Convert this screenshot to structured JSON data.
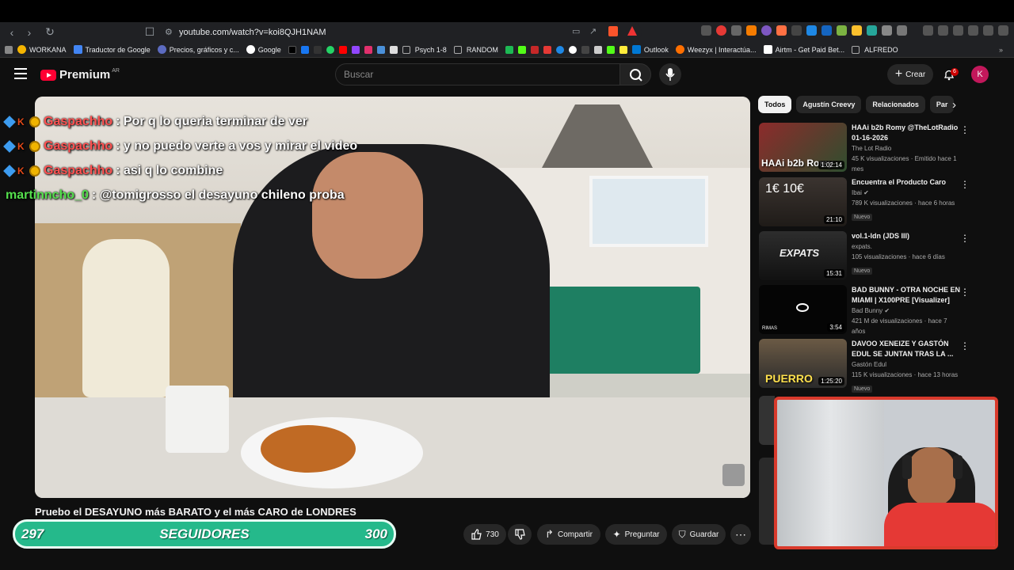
{
  "browser": {
    "url": "youtube.com/watch?v=koi8QJH1NAM",
    "bookmarks": [
      "WORKANA",
      "Traductor de Google",
      "Precios, gráficos y c...",
      "Google",
      "Psych 1-8",
      "RANDOM",
      "Outlook",
      "Weezyx | Interactúa...",
      "Airtm - Get Paid Bet...",
      "ALFREDO"
    ]
  },
  "header": {
    "logo_text": "Premium",
    "country": "AR",
    "search_placeholder": "Buscar",
    "create_label": "Crear",
    "notif_count": "6",
    "avatar_letter": "K"
  },
  "chat": [
    {
      "user": "Gaspachho",
      "msg": ": Por q lo queria terminar de ver",
      "color": "red"
    },
    {
      "user": "Gaspachho",
      "msg": ": y no puedo verte a vos y mirar el video",
      "color": "red"
    },
    {
      "user": "Gaspachho",
      "msg": ": asi q lo combine",
      "color": "red"
    },
    {
      "user": "martinncho_0",
      "msg": ": @tomigrosso el desayuno chileno proba",
      "color": "green"
    }
  ],
  "video": {
    "title": "Pruebo el DESAYUNO más BARATO y el más CARO de LONDRES",
    "likes": "730",
    "share_label": "Compartir",
    "ask_label": "Preguntar",
    "save_label": "Guardar"
  },
  "follow_goal": {
    "current": "297",
    "label": "SEGUIDORES",
    "target": "300",
    "progress_fraction": 0.99
  },
  "chips": [
    "Todos",
    "Agustín Creevy",
    "Relacionados",
    "Par"
  ],
  "recommendations": [
    {
      "title": "HAAi b2b Romy @TheLotRadio 01-16-2026",
      "channel": "The Lot Radio",
      "meta": "45 K visualizaciones · Emitido hace 1 mes",
      "duration": "1:02:14",
      "badge": "",
      "thumb_color": "#3a5a3a",
      "overlay": "HAAi b2b Romy"
    },
    {
      "title": "Encuentra el Producto Caro",
      "channel": "Ibai",
      "meta": "789 K visualizaciones · hace 6 horas",
      "duration": "21:10",
      "badge": "Nuevo",
      "thumb_color": "#2e2a28",
      "overlay": "1€   10€"
    },
    {
      "title": "vol.1-ldn (JDS III)",
      "channel": "expats.",
      "meta": "105 visualizaciones · hace 6 días",
      "duration": "15:31",
      "badge": "Nuevo",
      "thumb_color": "#1c1c1c",
      "overlay": "EXPATS"
    },
    {
      "title": "BAD BUNNY - OTRA NOCHE EN MIAMI | X100PRE [Visualizer]",
      "channel": "Bad Bunny",
      "meta": "421 M de visualizaciones · hace 7 años",
      "duration": "3:54",
      "badge": "",
      "thumb_color": "#050505",
      "overlay": "RIMAS"
    },
    {
      "title": "DAVOO XENEIZE Y GASTÓN EDUL SE JUNTAN TRAS LA ...",
      "channel": "Gastón Edul",
      "meta": "115 K visualizaciones · hace 13 horas",
      "duration": "1:25:20",
      "badge": "Nuevo",
      "thumb_color": "#4b3f2f",
      "overlay": "PUERRO"
    }
  ]
}
